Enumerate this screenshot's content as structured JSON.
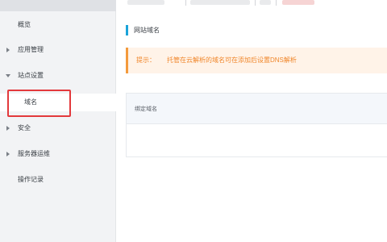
{
  "sidebar": {
    "items": [
      {
        "label": "概览",
        "arrow": "none"
      },
      {
        "label": "应用管理",
        "arrow": "right"
      },
      {
        "label": "站点设置",
        "arrow": "down"
      },
      {
        "label": "域名",
        "arrow": "none",
        "selected": true
      },
      {
        "label": "安全",
        "arrow": "right"
      },
      {
        "label": "服务器运维",
        "arrow": "right"
      },
      {
        "label": "操作记录",
        "arrow": "none"
      }
    ]
  },
  "main": {
    "section_title": "网站域名",
    "tip": {
      "prefix": "提示：",
      "text": "托管在云解析的域名可在添加后设置DNS解析"
    },
    "table": {
      "columns": [
        "绑定域名"
      ]
    }
  },
  "colors": {
    "accent": "#1aa3d9",
    "tip_text": "#f0862a",
    "tip_bg": "#fff3e8",
    "highlight": "#e3393c",
    "sidebar_bg": "#f2f3f5"
  }
}
